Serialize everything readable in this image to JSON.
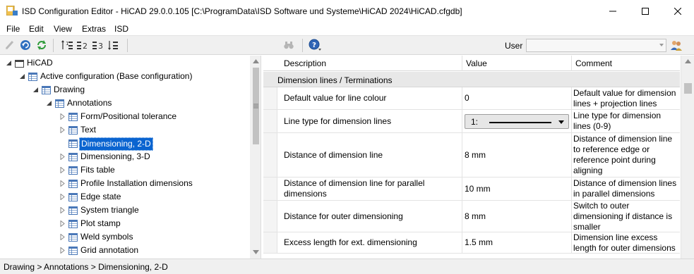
{
  "window": {
    "title": "ISD Configuration Editor  -  HiCAD 29.0.0.105 [C:\\ProgramData\\ISD Software und Systeme\\HiCAD 2024\\HiCAD.cfgdb]",
    "icons": {
      "app": "app-icon",
      "minimize": "minimize-icon",
      "maximize": "maximize-icon",
      "close": "close-icon"
    }
  },
  "menu": {
    "items": [
      "File",
      "Edit",
      "View",
      "Extras",
      "ISD"
    ]
  },
  "toolbar": {
    "icons": [
      "edit-pencil-icon",
      "undo-icon",
      "refresh-icon",
      "sort-tree-icon",
      "level-2-icon",
      "level-3-icon",
      "expand-levels-icon",
      "find-binoculars-icon",
      "help-icon"
    ],
    "user_label": "User",
    "user_value": "",
    "user_icon": "users-icon"
  },
  "tree": {
    "nodes": [
      {
        "label": "HiCAD",
        "expander": "expanded",
        "icon": "folder-icon"
      },
      {
        "label": "Active configuration (Base configuration)",
        "expander": "expanded",
        "icon": "table-icon"
      },
      {
        "label": "Drawing",
        "expander": "expanded",
        "icon": "table-icon"
      },
      {
        "label": "Annotations",
        "expander": "expanded",
        "icon": "table-icon"
      },
      {
        "label": "Form/Positional tolerance",
        "expander": "collapsed",
        "icon": "table-icon"
      },
      {
        "label": "Text",
        "expander": "collapsed",
        "icon": "table-icon"
      },
      {
        "label": "Dimensioning, 2-D",
        "expander": "none",
        "icon": "table-icon",
        "selected": true
      },
      {
        "label": "Dimensioning, 3-D",
        "expander": "collapsed",
        "icon": "table-icon"
      },
      {
        "label": "Fits table",
        "expander": "collapsed",
        "icon": "table-icon"
      },
      {
        "label": "Profile Installation dimensions",
        "expander": "collapsed",
        "icon": "table-icon"
      },
      {
        "label": "Edge state",
        "expander": "collapsed",
        "icon": "table-icon"
      },
      {
        "label": "System triangle",
        "expander": "collapsed",
        "icon": "table-icon"
      },
      {
        "label": "Plot stamp",
        "expander": "collapsed",
        "icon": "table-icon"
      },
      {
        "label": "Weld symbols",
        "expander": "collapsed",
        "icon": "table-icon"
      },
      {
        "label": "Grid annotation",
        "expander": "collapsed",
        "icon": "table-icon"
      }
    ]
  },
  "grid": {
    "columns": [
      "Description",
      "Value",
      "Comment"
    ],
    "group": "Dimension lines / Terminations",
    "rows": [
      {
        "description": "Default value for line colour",
        "value": "0",
        "comment": "Default value for dimension lines + projection lines"
      },
      {
        "description": "Line type for dimension lines",
        "value": "1:",
        "value_kind": "linetype-combo",
        "comment": "Line type for dimension lines (0-9)"
      },
      {
        "description": "Distance of dimension line",
        "value": "8 mm",
        "comment": "Distance of dimension line to reference edge or reference point during aligning"
      },
      {
        "description": "Distance of dimension line for parallel dimensions",
        "value": "10 mm",
        "comment": "Distance of dimension lines in parallel dimensions"
      },
      {
        "description": "Distance for outer dimensioning",
        "value": "8 mm",
        "comment": "Switch to outer dimensioning if distance is smaller"
      },
      {
        "description": "Excess length for ext. dimensioning",
        "value": "1.5 mm",
        "comment": "Dimension line excess length for outer dimensions"
      }
    ]
  },
  "statusbar": {
    "path": "Drawing > Annotations > Dimensioning, 2-D"
  }
}
